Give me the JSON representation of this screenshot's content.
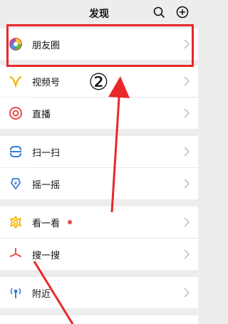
{
  "header": {
    "title": "发现",
    "search_icon": "search-icon",
    "add_icon": "plus-circle-icon"
  },
  "annotation": {
    "step_label": "②",
    "highlight_color": "#e8282c"
  },
  "items": [
    {
      "label": "朋友圈",
      "icon": "moments-aperture-icon"
    },
    {
      "label": "视频号",
      "icon": "channels-icon"
    },
    {
      "label": "直播",
      "icon": "live-icon"
    },
    {
      "label": "扫一扫",
      "icon": "scan-icon"
    },
    {
      "label": "摇一摇",
      "icon": "shake-icon"
    },
    {
      "label": "看一看",
      "icon": "top-stories-icon",
      "has_dot": true
    },
    {
      "label": "搜一搜",
      "icon": "search-star-icon"
    },
    {
      "label": "附近",
      "icon": "nearby-icon"
    }
  ]
}
